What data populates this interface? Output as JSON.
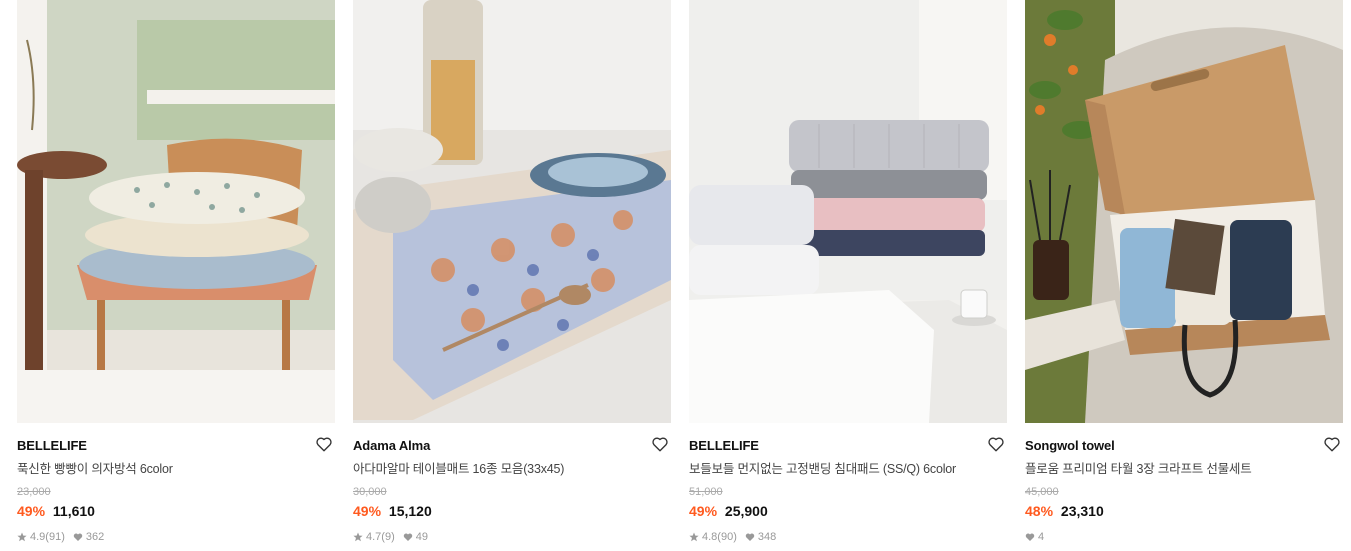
{
  "products": [
    {
      "brand": "BELLELIFE",
      "title": "푹신한 빵빵이 의자방석 6color",
      "original_price": "23,000",
      "discount": "49%",
      "price": "11,610",
      "rating": "4.9",
      "reviews": "(91)",
      "likes": "362",
      "image_icon": "chair-cushion-image",
      "colors": {
        "accent": "#ff5a1f"
      }
    },
    {
      "brand": "Adama Alma",
      "title": "아다마알마 테이블매트 16종 모음(33x45)",
      "original_price": "30,000",
      "discount": "49%",
      "price": "15,120",
      "rating": "4.7",
      "reviews": "(9)",
      "likes": "49",
      "image_icon": "table-mat-image"
    },
    {
      "brand": "BELLELIFE",
      "title": "보들보들 먼지없는 고정밴딩 침대패드 (SS/Q) 6color",
      "original_price": "51,000",
      "discount": "49%",
      "price": "25,900",
      "rating": "4.8",
      "reviews": "(90)",
      "likes": "348",
      "image_icon": "bed-pad-image"
    },
    {
      "brand": "Songwol towel",
      "title": "플로움 프리미엄 타월 3장 크라프트 선물세트",
      "original_price": "45,000",
      "discount": "48%",
      "price": "23,310",
      "likes": "4",
      "image_icon": "towel-gift-box-image"
    }
  ]
}
